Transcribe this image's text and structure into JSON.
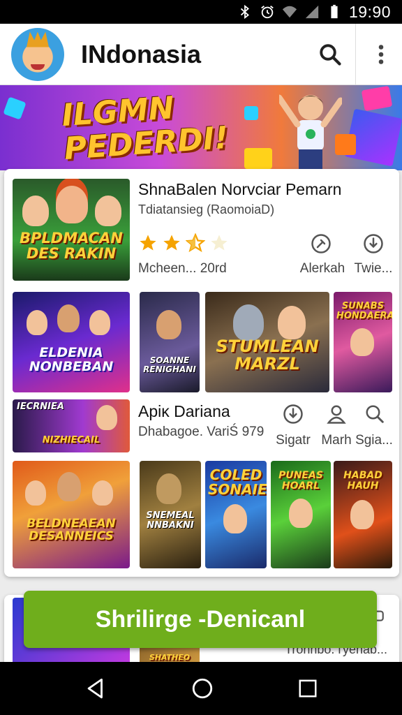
{
  "status_bar": {
    "time": "19:90"
  },
  "app_bar": {
    "title": "INdonasia"
  },
  "banner": {
    "line1": "ILGMN",
    "line2": "PEDERDI!"
  },
  "featured": {
    "thumb_title": "BPLDMACAN DES RAKIN",
    "name": "ShnaBalen Norvciar Pemarn",
    "developer": "Tdiatansieg (RaomoiaD)",
    "rating": 2.5,
    "meta": "Mcheen... 20rd",
    "actions": [
      {
        "icon": "alarm-icon",
        "label": "Alerkah"
      },
      {
        "icon": "download-icon",
        "label": "Twie..."
      }
    ]
  },
  "row1": [
    "ELDENIA NONBEBAN",
    "SOANNE RENIGHANI",
    "STUMLEAN MARZL",
    "SUNABS HONDAERAGE"
  ],
  "second_app": {
    "thumb_title": "IECRNIEA",
    "thumb_sub": "NIZHIECAIL",
    "name": "Apiκ Dariana",
    "developer": "Dhabagoe. VariŚ 979",
    "actions": [
      {
        "icon": "download-icon",
        "label": "Sigatr"
      },
      {
        "icon": "person-icon",
        "label": "Marh"
      },
      {
        "icon": "search-icon",
        "label": "Sgia..."
      }
    ]
  },
  "row2": [
    "BELDNEAEAN DESANNEICS",
    "SNEMEAL NNBAKNI",
    "COLED SONAIES",
    "PUNEAS HOARL",
    "HABAD HAUH"
  ],
  "card2": {
    "text": "Trohnbo. ѓyenab...",
    "thumb_text": "SHATHEO"
  },
  "cta": {
    "label": "Shrilirge -Denicanl"
  },
  "colors": {
    "cta_green": "#6fae1c",
    "banner_yellow": "#ffc42e"
  }
}
